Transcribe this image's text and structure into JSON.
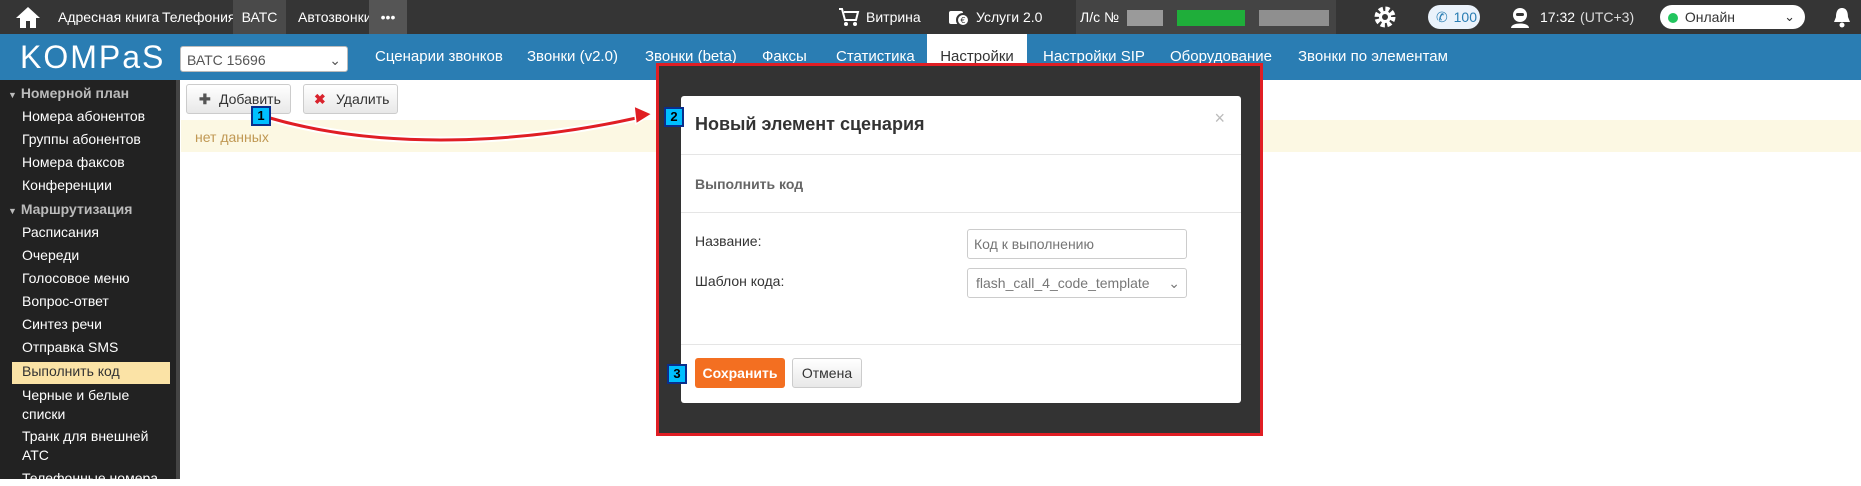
{
  "topbar": {
    "menu": [
      "Адресная книга",
      "Телефония",
      "ВАТС",
      "Автозвонки"
    ],
    "more": "•••",
    "showcase": "Витрина",
    "services": "Услуги 2.0",
    "account_label": "Л/с №",
    "calls_count": "100",
    "time": "17:32",
    "timezone": "(UTC+3)",
    "status": "Онлайн"
  },
  "brand": {
    "logo": "KOMPaS"
  },
  "navbar": {
    "vatc_select": "ВАТС 15696",
    "tabs": [
      "Сценарии звонков",
      "Звонки (v2.0)",
      "Звонки (beta)",
      "Факсы",
      "Статистика",
      "Настройки",
      "Настройки SIP",
      "Оборудование",
      "Звонки по элементам"
    ],
    "active_tab": "Настройки"
  },
  "sidebar": {
    "section1": "Номерной план",
    "section1_items": [
      "Номера абонентов",
      "Группы абонентов",
      "Номера факсов",
      "Конференции"
    ],
    "section2": "Маршрутизация",
    "section2_items": [
      "Расписания",
      "Очереди",
      "Голосовое меню",
      "Вопрос-ответ",
      "Синтез речи",
      "Отправка SMS",
      "Выполнить код",
      "Черные и белые",
      "списки",
      "Транк для внешней",
      "АТС",
      "Телефонные номера"
    ],
    "active_item": "Выполнить код"
  },
  "toolbar": {
    "add_label": "Добавить",
    "delete_label": "Удалить"
  },
  "content": {
    "no_data": "нет данных"
  },
  "modal": {
    "title": "Новый элемент сценария",
    "close": "×",
    "subtitle": "Выполнить код",
    "name_label": "Название:",
    "name_placeholder": "Код к выполнению",
    "template_label": "Шаблон кода:",
    "template_value": "flash_call_4_code_template",
    "save_label": "Сохранить",
    "cancel_label": "Отмена"
  },
  "markers": [
    "1",
    "2",
    "3"
  ],
  "colors": {
    "topbar": "#353535",
    "navbar": "#2a7db3",
    "sidebar": "#222222",
    "active_item": "#fbe3a6",
    "save_button": "#f36f21",
    "highlight_border": "#e01e24",
    "marker": "#00bfff",
    "online_dot": "#22c55e"
  }
}
